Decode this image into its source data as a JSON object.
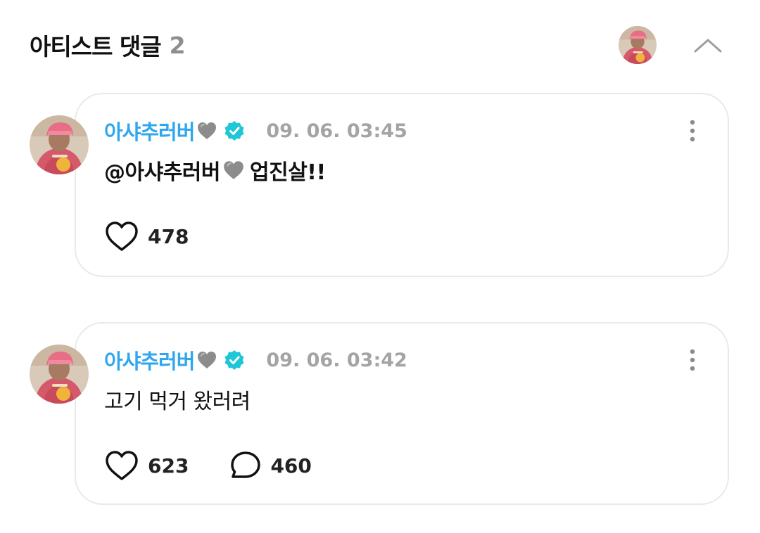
{
  "header": {
    "title": "아티스트 댓글",
    "count": "2",
    "avatar_icon": "artist-avatar",
    "collapse_icon": "chevron-up-icon"
  },
  "comments": [
    {
      "author": "아샤추러버",
      "author_emoji": "grey-heart",
      "verified_icon": "verified-badge-icon",
      "timestamp": "09. 06. 03:45",
      "text_mention": "@아샤추러버",
      "text_suffix": "업진살!!",
      "likes": "478"
    },
    {
      "author": "아샤추러버",
      "author_emoji": "grey-heart",
      "verified_icon": "verified-badge-icon",
      "timestamp": "09. 06. 03:42",
      "text": "고기 먹거 왔러려",
      "likes": "623",
      "replies": "460"
    }
  ],
  "colors": {
    "author": "#2fa6ee",
    "verified": "#1fc6d6",
    "timestamp": "#a4a4a4",
    "card_border": "#e9e9e9",
    "count": "#8e8e8e"
  }
}
